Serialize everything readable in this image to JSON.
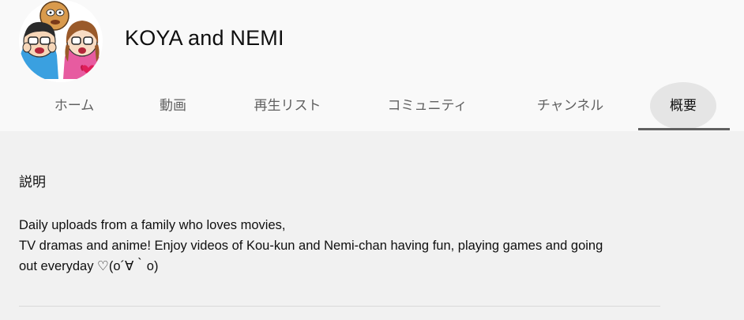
{
  "channel": {
    "name": "KOYA and NEMI"
  },
  "tabs": [
    {
      "label": "ホーム",
      "active": false
    },
    {
      "label": "動画",
      "active": false
    },
    {
      "label": "再生リスト",
      "active": false
    },
    {
      "label": "コミュニティ",
      "active": false
    },
    {
      "label": "チャンネル",
      "active": false
    },
    {
      "label": "概要",
      "active": true
    }
  ],
  "about": {
    "section_title": "説明",
    "description_lines": [
      "Daily uploads from a family who loves movies,",
      "TV dramas and anime! Enjoy videos of Kou-kun and Nemi-chan having fun, playing games and going",
      "out everyday ♡(o´∀｀o)"
    ]
  },
  "colors": {
    "header_bg": "#f9f9f9",
    "content_bg": "#f1f1f1",
    "tab_active_indicator": "#606060",
    "tab_text": "#606060"
  }
}
